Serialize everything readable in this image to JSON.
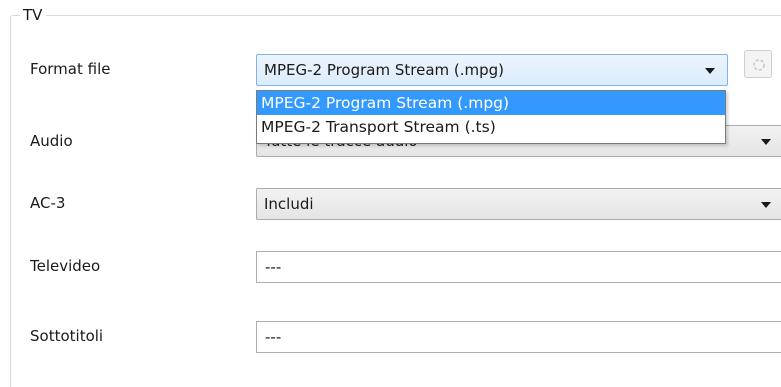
{
  "group": {
    "title": "TV"
  },
  "fields": {
    "format_file": {
      "label": "Format file",
      "value": "MPEG-2 Program Stream (.mpg)",
      "options": [
        "MPEG-2 Program Stream (.mpg)",
        "MPEG-2 Transport Stream (.ts)"
      ],
      "selected_index": 0
    },
    "audio": {
      "label": "Audio",
      "value": "Tutte le tracce audio"
    },
    "ac3": {
      "label": "AC-3",
      "value": "Includi"
    },
    "televideo": {
      "label": "Televideo",
      "value": "---"
    },
    "sottotitoli": {
      "label": "Sottotitoli",
      "value": "---"
    }
  },
  "icons": {
    "side_button": "settings-icon",
    "dropdown_arrow": "chevron-down-icon"
  },
  "colors": {
    "selection": "#3399ff",
    "border": "#acacac"
  }
}
